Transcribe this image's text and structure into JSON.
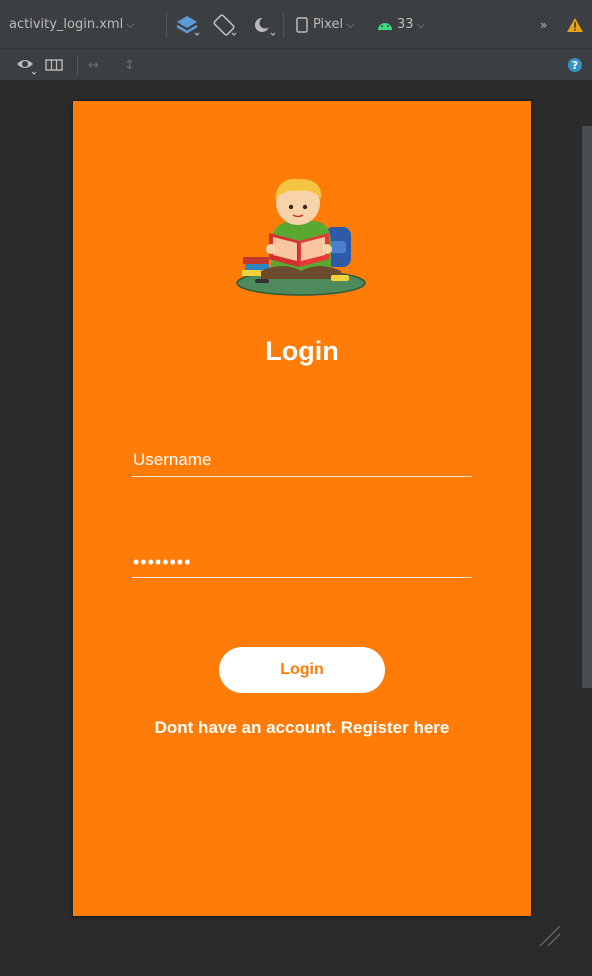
{
  "toolbar": {
    "file_tab": "activity_login.xml",
    "device": "Pixel",
    "api_level": "33"
  },
  "screen": {
    "title": "Login",
    "username_hint": "Username",
    "password_value": "••••••••",
    "login_button": "Login",
    "register_link": "Dont have an account. Register here"
  },
  "colors": {
    "screen_bg": "#ff7c08",
    "ide_bg": "#2b2b2b",
    "toolbar_bg": "#3c3f41",
    "warning": "#e8a317",
    "help": "#3592c4"
  }
}
